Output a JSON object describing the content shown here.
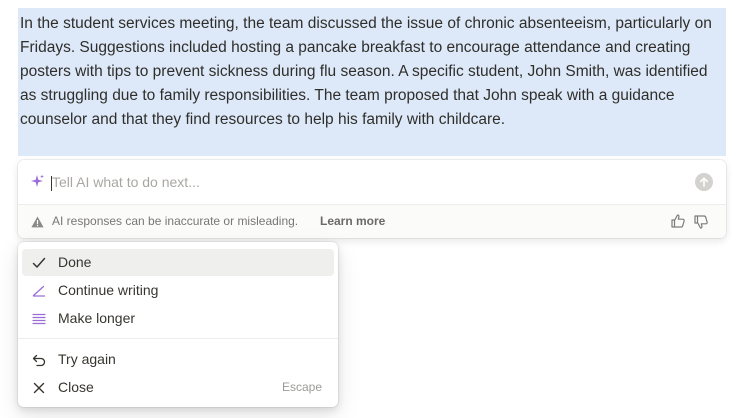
{
  "generated_text": "In the student services meeting, the team discussed the issue of chronic absenteeism, particularly on Fridays. Suggestions included hosting a pancake breakfast to encourage attendance and creating posters with tips to prevent sickness during flu season. A specific student, John Smith, was identified as struggling due to family responsibilities. The team proposed that John speak with a guidance counselor and that they find resources to help his family with childcare.",
  "ai_prompt": {
    "placeholder": "Tell AI what to do next...",
    "value": "",
    "icon": "sparkle-icon",
    "submit_icon": "arrow-up-icon"
  },
  "ai_footer": {
    "disclaimer": "AI responses can be inaccurate or misleading.",
    "learn_more": "Learn more",
    "icons": [
      "warning-icon",
      "thumbs-up-icon",
      "thumbs-down-icon"
    ]
  },
  "menu": {
    "primary": [
      {
        "label": "Done",
        "icon": "checkmark-icon",
        "selected": true
      },
      {
        "label": "Continue writing",
        "icon": "pen-icon",
        "selected": false
      },
      {
        "label": "Make longer",
        "icon": "text-lines-icon",
        "selected": false
      }
    ],
    "secondary": [
      {
        "label": "Try again",
        "icon": "undo-icon",
        "shortcut": ""
      },
      {
        "label": "Close",
        "icon": "close-icon",
        "shortcut": "Escape"
      }
    ]
  },
  "colors": {
    "highlight": "#dde9f8",
    "accent_purple": "#9a6dd7",
    "selected_item": "#efefed"
  }
}
